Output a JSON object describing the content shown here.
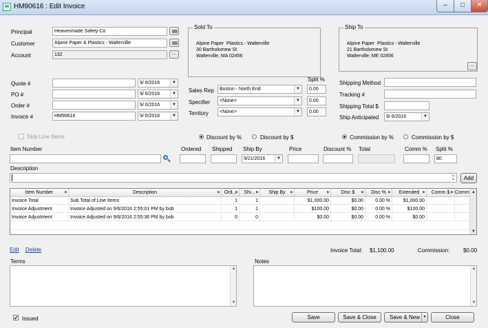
{
  "window": {
    "title": "HM90616 : Edit Invoice"
  },
  "header": {
    "principal_label": "Principal",
    "principal_value": "Heavenmade Safety Co",
    "customer_label": "Customer",
    "customer_value": "Alpine Paper & Plastics - Walterville",
    "account_label": "Account",
    "account_value": "132"
  },
  "sold_to": {
    "title": "Sold To",
    "line1": "Alpine Paper  Plastics - Walterville",
    "line2": "30 Bartholomew St",
    "line3": "Walterville, MA 02456"
  },
  "ship_to": {
    "title": "Ship To",
    "line1": "Alpine Paper  Plastics - Walterville",
    "line2": "21 Bartholomew St",
    "line3": "Walterville, ME 02456",
    "more_label": "..."
  },
  "numbers": {
    "quote_label": "Quote #",
    "quote_value": "",
    "quote_date": "9/  6/2016",
    "po_label": "PO #",
    "po_value": "",
    "po_date": "9/  6/2016",
    "order_label": "Order #",
    "order_value": "",
    "order_date": "9/  6/2016",
    "invoice_label": "Invoice #",
    "invoice_value": "HM90616",
    "invoice_date": "9/  6/2016"
  },
  "reps": {
    "split_label": "Split %",
    "sales_rep_label": "Sales Rep",
    "sales_rep_value": "Boston - North End",
    "sales_rep_split": "0.00",
    "specifier_label": "Specifier",
    "specifier_value": "<None>",
    "specifier_split": "0.00",
    "territory_label": "Territory",
    "territory_value": "<None>",
    "territory_split": "0.00"
  },
  "shipping": {
    "method_label": "Shipping Method",
    "method_value": "",
    "tracking_label": "Tracking #",
    "tracking_value": "",
    "total_label": "Shipping Total $",
    "total_value": "",
    "anticipated_label": "Ship Anticipated",
    "anticipated_value": "9/  6/2016"
  },
  "options": {
    "skip_line_items": "Skip Line Items",
    "discount_pct": "Discount by %",
    "discount_amt": "Discount by $",
    "commission_pct": "Commission by %",
    "commission_amt": "Commission by $"
  },
  "line_entry": {
    "item_number_label": "Item Number",
    "item_number_value": "",
    "ordered_label": "Ordered",
    "shipped_label": "Shipped",
    "ship_by_label": "Ship By",
    "ship_by_value": "9/21/2016",
    "price_label": "Price",
    "discount_label": "Discount %",
    "total_label": "Total",
    "comm_label": "Comm %",
    "split_label": "Split %",
    "split_value": "80",
    "description_label": "Description",
    "add_label": "Add"
  },
  "grid": {
    "columns": [
      "Item Number",
      "Description",
      "Ord...",
      "Shi...",
      "Ship By",
      "Price",
      "Disc $",
      "Disc %",
      "Extended",
      "Comm $",
      "Comm %"
    ],
    "rows": [
      [
        "Invoice Total",
        "Sub Total of Line Items",
        "1",
        "1",
        "",
        "$1,000.00",
        "$0.00",
        "0.00 %",
        "$1,000.00",
        "",
        ""
      ],
      [
        "Invoice Adjustment",
        "Invoice Adjusted on 9/6/2016 2:55:01 PM by bob",
        "1",
        "1",
        "",
        "$100.00",
        "$0.00",
        "0.00 %",
        "$100.00",
        "",
        ""
      ],
      [
        "Invoice Adjustment",
        "Invoice Adjusted on 9/6/2016 2:55:36 PM by bob",
        "0",
        "0",
        "",
        "$0.00",
        "$0.00",
        "0.00 %",
        "$0.00",
        "",
        ""
      ]
    ]
  },
  "footer": {
    "edit_label": "Edit",
    "delete_label": "Delete",
    "invoice_total_label": "Invoice Total:",
    "invoice_total_value": "$1,100.00",
    "commission_label": "Commission:",
    "commission_value": "$0.00",
    "terms_label": "Terms",
    "notes_label": "Notes",
    "issued_label": "Issued",
    "save_label": "Save",
    "save_close_label": "Save & Close",
    "save_new_label": "Save & New",
    "close_label": "Close"
  }
}
